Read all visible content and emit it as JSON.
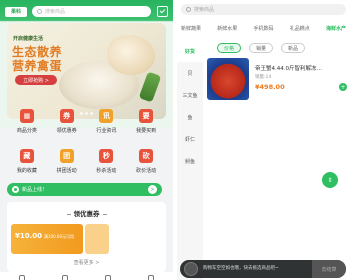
{
  "left": {
    "logo": "果科",
    "search_placeholder": "搜索商品",
    "banner": {
      "small": "开启健康生活",
      "line1": "生态散养",
      "line2": "营养禽蛋",
      "button": "立即抢购 >"
    },
    "nav": [
      {
        "label": "商品分类",
        "icon": "category-icon",
        "color": "#e8533b",
        "glyph": "▦"
      },
      {
        "label": "领优惠券",
        "icon": "coupon-icon",
        "color": "#e8533b",
        "glyph": "券"
      },
      {
        "label": "行业资讯",
        "icon": "news-icon",
        "color": "#f0a12a",
        "glyph": "讯"
      },
      {
        "label": "我要买到",
        "icon": "want-icon",
        "color": "#e8533b",
        "glyph": "要"
      },
      {
        "label": "我的收藏",
        "icon": "favorite-icon",
        "color": "#e8533b",
        "glyph": "藏"
      },
      {
        "label": "拼团活动",
        "icon": "group-icon",
        "color": "#f0a12a",
        "glyph": "团"
      },
      {
        "label": "秒杀活动",
        "icon": "flash-sale-icon",
        "color": "#e8533b",
        "glyph": "秒"
      },
      {
        "label": "砍价活动",
        "icon": "bargain-icon",
        "color": "#e8533b",
        "glyph": "砍"
      }
    ],
    "notice": "新品上线！",
    "notice_arrow": ">",
    "coupons": {
      "title": "领优惠券",
      "card_amount": "¥10.00",
      "card_condition": "满100.00元可用",
      "more": "查看更多 >"
    }
  },
  "right": {
    "search_placeholder": "搜索商品",
    "tabs": [
      "新鲜蔬果",
      "新鲜水果",
      "手机数码",
      "礼品糕点",
      "海鲜水产"
    ],
    "active_tab": 4,
    "side": [
      "好货",
      "贝",
      "三文鱼",
      "鱼",
      "虾仁",
      "鲟鱼"
    ],
    "active_side": 0,
    "filters": [
      "价格",
      "销量",
      "新品"
    ],
    "active_filter": 0,
    "product": {
      "name": "帝王蟹4.44.0斤智利解冻…",
      "sales": "销量:14",
      "price": "¥498.00",
      "add": "+"
    },
    "float_button": "⇕",
    "cart": {
      "text": "购物车空空如也哦，快去挑选商品吧~",
      "button": "去结算"
    }
  },
  "colors": {
    "accent": "#2fbf62",
    "price": "#ef7b1d",
    "coupon": "#f6b23c"
  }
}
